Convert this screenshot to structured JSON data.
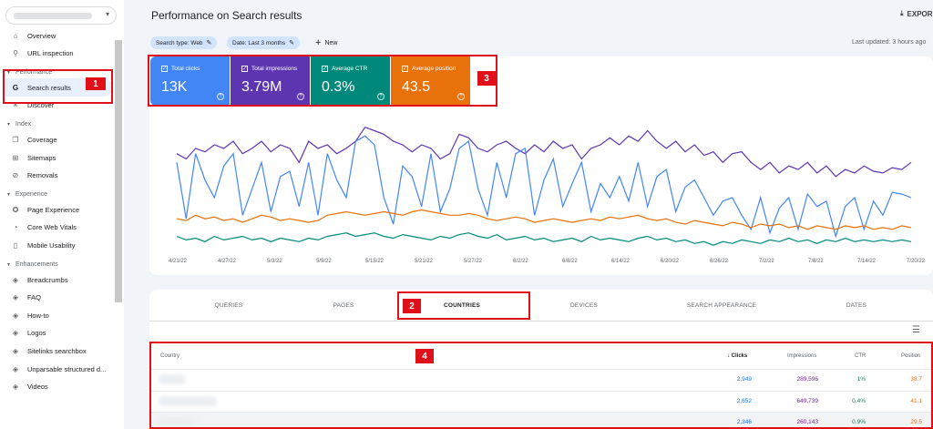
{
  "sidebar": {
    "property_arrow": "▾",
    "items_top": [
      {
        "label": "Overview",
        "icon": "home-icon",
        "glyph": "⌂"
      },
      {
        "label": "URL inspection",
        "icon": "search-icon",
        "glyph": "⚲"
      }
    ],
    "sections": [
      {
        "title": "Performance",
        "items": [
          {
            "label": "Search results",
            "icon": "google-g-icon",
            "glyph": "G",
            "active": true
          },
          {
            "label": "Discover",
            "icon": "asterisk-icon",
            "glyph": "✳"
          }
        ]
      },
      {
        "title": "Index",
        "items": [
          {
            "label": "Coverage",
            "icon": "pages-icon",
            "glyph": "❐"
          },
          {
            "label": "Sitemaps",
            "icon": "sitemap-icon",
            "glyph": "⊞"
          },
          {
            "label": "Removals",
            "icon": "eye-off-icon",
            "glyph": "⊘"
          }
        ]
      },
      {
        "title": "Experience",
        "items": [
          {
            "label": "Page Experience",
            "icon": "star-badge-icon",
            "glyph": "✪"
          },
          {
            "label": "Core Web Vitals",
            "icon": "speed-icon",
            "glyph": "◔"
          },
          {
            "label": "Mobile Usability",
            "icon": "phone-icon",
            "glyph": "▯"
          }
        ]
      },
      {
        "title": "Enhancements",
        "items": [
          {
            "label": "Breadcrumbs",
            "icon": "layers-icon",
            "glyph": "◈"
          },
          {
            "label": "FAQ",
            "icon": "layers-icon",
            "glyph": "◈"
          },
          {
            "label": "How-to",
            "icon": "layers-icon",
            "glyph": "◈"
          },
          {
            "label": "Logos",
            "icon": "layers-icon",
            "glyph": "◈"
          },
          {
            "label": "Sitelinks searchbox",
            "icon": "layers-icon",
            "glyph": "◈"
          },
          {
            "label": "Unparsable structured d...",
            "icon": "layers-icon",
            "glyph": "◈"
          },
          {
            "label": "Videos",
            "icon": "layers-icon",
            "glyph": "◈"
          }
        ]
      }
    ]
  },
  "header": {
    "title": "Performance on Search results",
    "export_label": "EXPOR",
    "last_updated": "Last updated: 3 hours ago"
  },
  "filters": {
    "search_type": "Search type: Web",
    "date": "Date: Last 3 months",
    "new_label": "New"
  },
  "metrics": [
    {
      "label": "Total clicks",
      "value": "13K",
      "color": "#4285f4"
    },
    {
      "label": "Total impressions",
      "value": "3.79M",
      "color": "#5e35b1"
    },
    {
      "label": "Average CTR",
      "value": "0.3%",
      "color": "#00897b"
    },
    {
      "label": "Average position",
      "value": "43.5",
      "color": "#e8710a"
    }
  ],
  "annotations": [
    "1",
    "2",
    "3",
    "4"
  ],
  "chart_data": {
    "type": "line",
    "x_ticks": [
      "4/21/22",
      "4/27/22",
      "5/3/22",
      "5/9/22",
      "5/15/22",
      "5/21/22",
      "5/27/22",
      "6/2/22",
      "6/8/22",
      "6/14/22",
      "6/20/22",
      "6/26/22",
      "7/2/22",
      "7/8/22",
      "7/14/22",
      "7/20/22"
    ],
    "series": [
      {
        "name": "Total impressions",
        "color": "#5e35b1",
        "values": [
          0.55,
          0.52,
          0.58,
          0.56,
          0.6,
          0.58,
          0.62,
          0.55,
          0.58,
          0.62,
          0.56,
          0.6,
          0.58,
          0.5,
          0.62,
          0.58,
          0.6,
          0.55,
          0.58,
          0.62,
          0.7,
          0.68,
          0.66,
          0.62,
          0.6,
          0.56,
          0.6,
          0.58,
          0.52,
          0.55,
          0.66,
          0.64,
          0.58,
          0.56,
          0.6,
          0.62,
          0.58,
          0.55,
          0.6,
          0.56,
          0.62,
          0.58,
          0.6,
          0.52,
          0.58,
          0.6,
          0.64,
          0.6,
          0.65,
          0.62,
          0.68,
          0.62,
          0.58,
          0.62,
          0.56,
          0.6,
          0.54,
          0.56,
          0.5,
          0.55,
          0.56,
          0.5,
          0.46,
          0.5,
          0.44,
          0.48,
          0.46,
          0.5,
          0.44,
          0.48,
          0.42,
          0.46,
          0.44,
          0.48,
          0.45,
          0.44,
          0.47,
          0.46,
          0.5
        ]
      },
      {
        "name": "Total clicks",
        "color": "#4285f4",
        "values": [
          0.5,
          0.18,
          0.55,
          0.4,
          0.3,
          0.48,
          0.55,
          0.2,
          0.35,
          0.5,
          0.22,
          0.42,
          0.45,
          0.25,
          0.5,
          0.2,
          0.55,
          0.4,
          0.3,
          0.62,
          0.65,
          0.6,
          0.3,
          0.15,
          0.48,
          0.42,
          0.25,
          0.55,
          0.22,
          0.35,
          0.58,
          0.62,
          0.35,
          0.2,
          0.5,
          0.3,
          0.55,
          0.58,
          0.2,
          0.4,
          0.52,
          0.25,
          0.38,
          0.5,
          0.22,
          0.38,
          0.3,
          0.42,
          0.28,
          0.5,
          0.25,
          0.42,
          0.46,
          0.22,
          0.36,
          0.4,
          0.3,
          0.2,
          0.28,
          0.3,
          0.2,
          0.12,
          0.3,
          0.1,
          0.24,
          0.3,
          0.12,
          0.32,
          0.25,
          0.28,
          0.08,
          0.25,
          0.3,
          0.12,
          0.28,
          0.2,
          0.33,
          0.32,
          0.3
        ]
      },
      {
        "name": "Average position",
        "color": "#e8710a",
        "values": [
          0.18,
          0.17,
          0.2,
          0.18,
          0.19,
          0.17,
          0.18,
          0.16,
          0.18,
          0.2,
          0.19,
          0.17,
          0.18,
          0.17,
          0.16,
          0.17,
          0.2,
          0.21,
          0.22,
          0.21,
          0.2,
          0.21,
          0.22,
          0.21,
          0.2,
          0.22,
          0.23,
          0.22,
          0.21,
          0.2,
          0.2,
          0.21,
          0.2,
          0.18,
          0.17,
          0.18,
          0.19,
          0.18,
          0.16,
          0.17,
          0.18,
          0.17,
          0.16,
          0.17,
          0.18,
          0.17,
          0.19,
          0.18,
          0.19,
          0.2,
          0.18,
          0.17,
          0.18,
          0.16,
          0.15,
          0.17,
          0.16,
          0.15,
          0.14,
          0.16,
          0.15,
          0.13,
          0.15,
          0.14,
          0.15,
          0.13,
          0.14,
          0.12,
          0.14,
          0.13,
          0.12,
          0.14,
          0.13,
          0.14,
          0.12,
          0.13,
          0.12,
          0.14,
          0.13
        ]
      },
      {
        "name": "Average CTR",
        "color": "#00897b",
        "values": [
          0.08,
          0.06,
          0.07,
          0.05,
          0.08,
          0.06,
          0.07,
          0.08,
          0.06,
          0.07,
          0.05,
          0.07,
          0.06,
          0.05,
          0.07,
          0.06,
          0.08,
          0.09,
          0.1,
          0.08,
          0.09,
          0.1,
          0.08,
          0.07,
          0.09,
          0.08,
          0.07,
          0.06,
          0.08,
          0.07,
          0.09,
          0.1,
          0.08,
          0.07,
          0.09,
          0.06,
          0.07,
          0.08,
          0.06,
          0.07,
          0.05,
          0.06,
          0.07,
          0.05,
          0.08,
          0.06,
          0.07,
          0.06,
          0.05,
          0.07,
          0.08,
          0.06,
          0.07,
          0.05,
          0.06,
          0.04,
          0.05,
          0.03,
          0.05,
          0.04,
          0.06,
          0.05,
          0.04,
          0.06,
          0.05,
          0.07,
          0.05,
          0.06,
          0.04,
          0.06,
          0.05,
          0.07,
          0.05,
          0.06,
          0.05,
          0.06,
          0.05,
          0.06,
          0.05
        ]
      }
    ]
  },
  "tabs": [
    {
      "label": "QUERIES"
    },
    {
      "label": "PAGES"
    },
    {
      "label": "COUNTRIES",
      "active": true
    },
    {
      "label": "DEVICES"
    },
    {
      "label": "SEARCH APPEARANCE"
    },
    {
      "label": "DATES"
    }
  ],
  "table": {
    "headers": {
      "country": "Country",
      "clicks": "Clicks",
      "impressions": "Impressions",
      "ctr": "CTR",
      "position": "Position"
    },
    "sort_arrow": "↓",
    "rows": [
      {
        "clicks": "2,949",
        "impressions": "289,596",
        "ctr": "1%",
        "position": "38.7"
      },
      {
        "clicks": "2,652",
        "impressions": "649,739",
        "ctr": "0.4%",
        "position": "41.1"
      },
      {
        "clicks": "2,346",
        "impressions": "260,143",
        "ctr": "0.9%",
        "position": "29.5"
      }
    ]
  }
}
